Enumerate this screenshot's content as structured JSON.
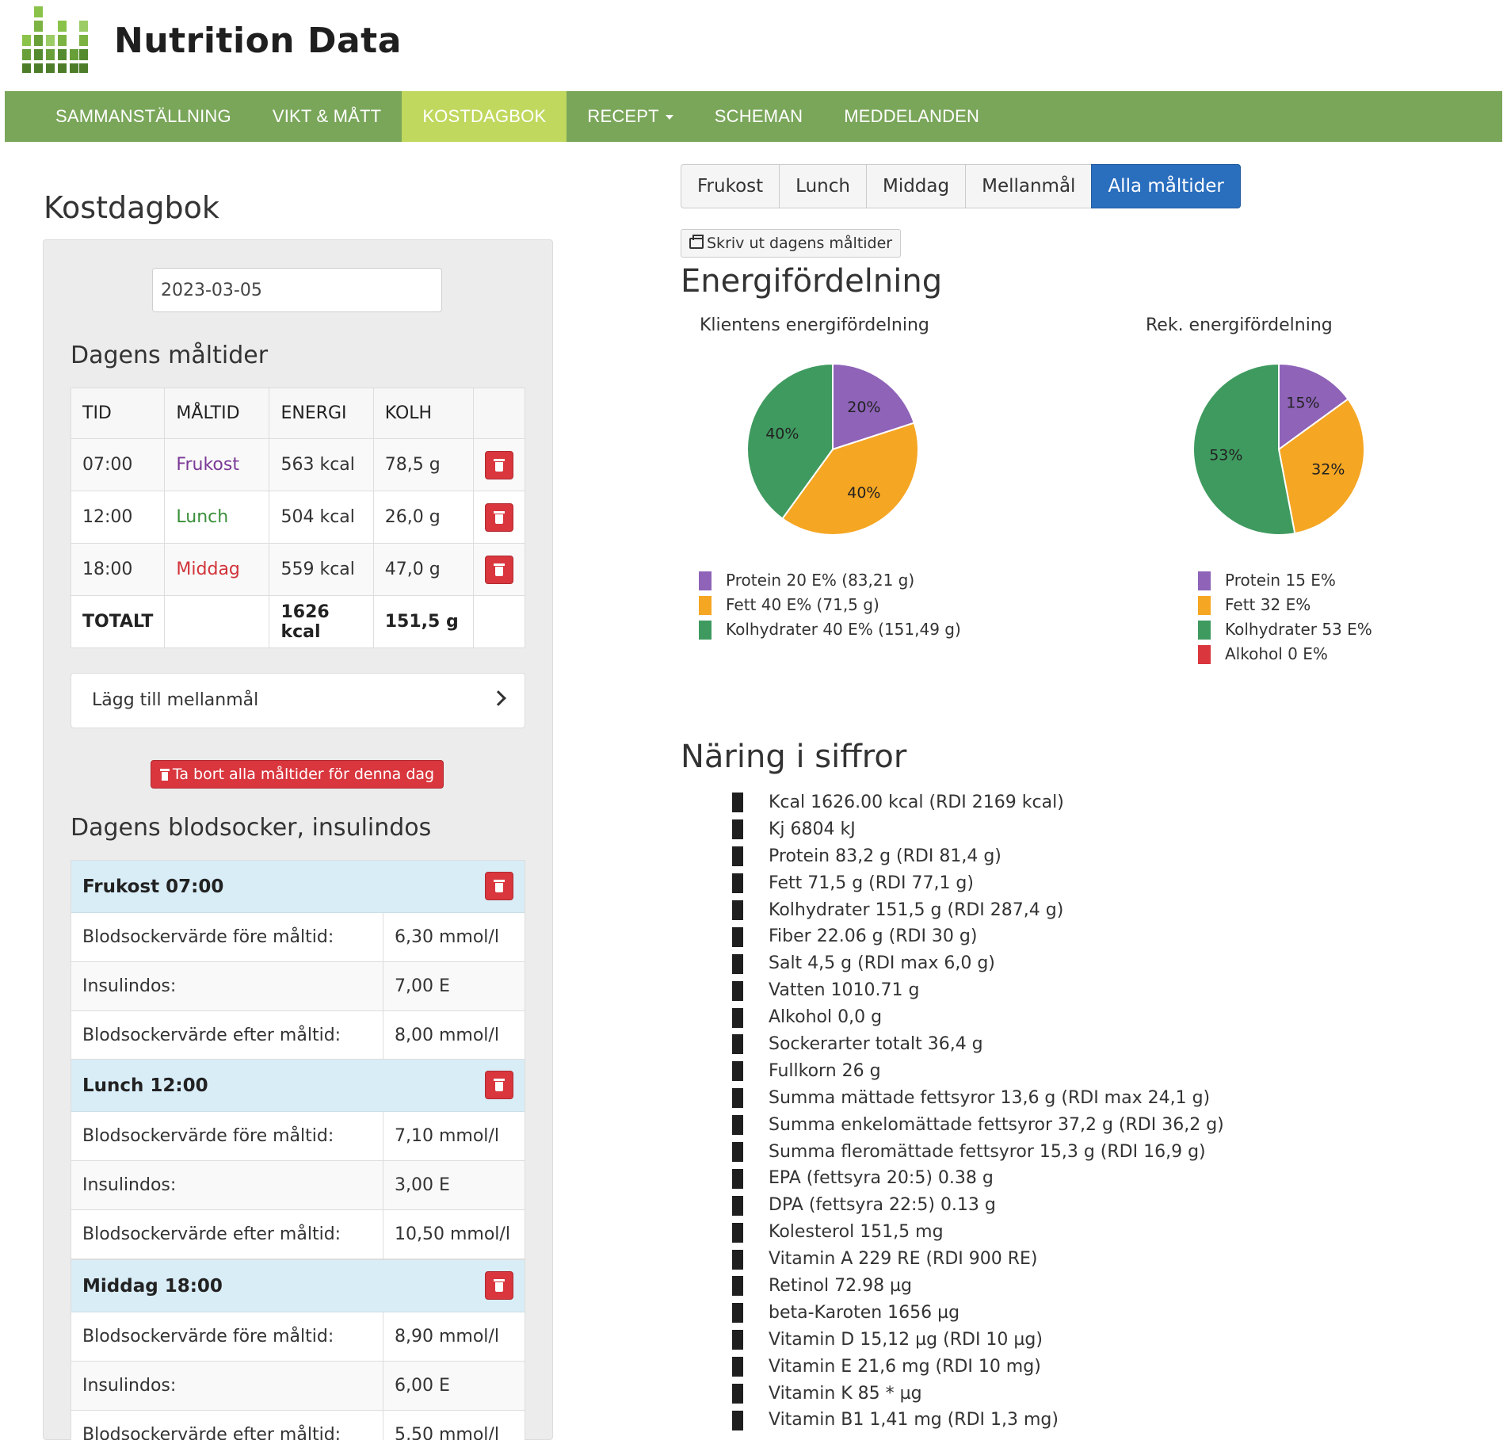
{
  "brand": {
    "name": "Nutrition Data"
  },
  "nav": {
    "items": [
      {
        "label": "SAMMANSTÄLLNING"
      },
      {
        "label": "VIKT & MÅTT"
      },
      {
        "label": "KOSTDAGBOK"
      },
      {
        "label": "RECEPT"
      },
      {
        "label": "SCHEMAN"
      },
      {
        "label": "MEDDELANDEN"
      }
    ],
    "active": "KOSTDAGBOK"
  },
  "page": {
    "title": "Kostdagbok"
  },
  "date": {
    "value": "2023-03-05"
  },
  "meals": {
    "heading": "Dagens måltider",
    "columns": [
      "TID",
      "MÅLTID",
      "ENERGI",
      "KOLH"
    ],
    "rows": [
      {
        "time": "07:00",
        "meal": "Frukost",
        "energy": "563 kcal",
        "carbs": "78,5 g",
        "color": "#7b3a96"
      },
      {
        "time": "12:00",
        "meal": "Lunch",
        "energy": "504 kcal",
        "carbs": "26,0 g",
        "color": "#3a8f3a"
      },
      {
        "time": "18:00",
        "meal": "Middag",
        "energy": "559 kcal",
        "carbs": "47,0 g",
        "color": "#d1343a"
      }
    ],
    "total": {
      "label": "TOTALT",
      "energy": "1626 kcal",
      "carbs": "151,5 g"
    }
  },
  "add_snack": {
    "label": "Lägg till mellanmål"
  },
  "delete_all": {
    "label": "Ta bort alla måltider för denna dag"
  },
  "blood_sugar": {
    "heading": "Dagens blodsocker, insulindos",
    "blocks": [
      {
        "title": "Frukost 07:00",
        "rows": [
          {
            "label": "Blodsockervärde före måltid:",
            "value": "6,30 mmol/l"
          },
          {
            "label": "Insulindos:",
            "value": "7,00 E"
          },
          {
            "label": "Blodsockervärde efter måltid:",
            "value": "8,00 mmol/l"
          }
        ]
      },
      {
        "title": "Lunch 12:00",
        "rows": [
          {
            "label": "Blodsockervärde före måltid:",
            "value": "7,10 mmol/l"
          },
          {
            "label": "Insulindos:",
            "value": "3,00 E"
          },
          {
            "label": "Blodsockervärde efter måltid:",
            "value": "10,50 mmol/l"
          }
        ]
      },
      {
        "title": "Middag 18:00",
        "rows": [
          {
            "label": "Blodsockervärde före måltid:",
            "value": "8,90 mmol/l"
          },
          {
            "label": "Insulindos:",
            "value": "6,00 E"
          },
          {
            "label": "Blodsockervärde efter måltid:",
            "value": "5,50 mmol/l"
          }
        ]
      }
    ]
  },
  "meal_filter": {
    "tabs": [
      "Frukost",
      "Lunch",
      "Middag",
      "Mellanmål",
      "Alla måltider"
    ],
    "active": "Alla måltider"
  },
  "print": {
    "label": "Skriv ut dagens måltider"
  },
  "energy": {
    "heading": "Energifördelning",
    "colors": {
      "protein": "#8e63b8",
      "fat": "#f5a623",
      "carbs": "#3f9a5f",
      "alcohol": "#d9363e"
    }
  },
  "chart_data": [
    {
      "type": "pie",
      "title": "Klientens energifördelning",
      "slices": [
        {
          "name": "Protein",
          "value": 20,
          "label": "20%",
          "color": "#8e63b8"
        },
        {
          "name": "Fett",
          "value": 40,
          "label": "40%",
          "color": "#f5a623"
        },
        {
          "name": "Kolhydrater",
          "value": 40,
          "label": "40%",
          "color": "#3f9a5f"
        }
      ],
      "legend": [
        {
          "text": "Protein 20 E% (83,21 g)",
          "color": "#8e63b8"
        },
        {
          "text": "Fett 40 E% (71,5 g)",
          "color": "#f5a623"
        },
        {
          "text": "Kolhydrater 40 E% (151,49 g)",
          "color": "#3f9a5f"
        }
      ]
    },
    {
      "type": "pie",
      "title": "Rek. energifördelning",
      "slices": [
        {
          "name": "Protein",
          "value": 15,
          "label": "15%",
          "color": "#8e63b8"
        },
        {
          "name": "Fett",
          "value": 32,
          "label": "32%",
          "color": "#f5a623"
        },
        {
          "name": "Kolhydrater",
          "value": 53,
          "label": "53%",
          "color": "#3f9a5f"
        },
        {
          "name": "Alkohol",
          "value": 0,
          "label": "",
          "color": "#d9363e"
        }
      ],
      "legend": [
        {
          "text": "Protein 15 E%",
          "color": "#8e63b8"
        },
        {
          "text": "Fett 32 E%",
          "color": "#f5a623"
        },
        {
          "text": "Kolhydrater 53 E%",
          "color": "#3f9a5f"
        },
        {
          "text": "Alkohol 0 E%",
          "color": "#d9363e"
        }
      ]
    }
  ],
  "nutrition": {
    "heading": "Näring i siffror",
    "items": [
      "Kcal 1626.00 kcal (RDI 2169 kcal)",
      "Kj 6804 kJ",
      "Protein 83,2 g (RDI 81,4 g)",
      "Fett 71,5 g (RDI 77,1 g)",
      "Kolhydrater 151,5 g (RDI 287,4 g)",
      "Fiber 22.06 g (RDI 30 g)",
      "Salt 4,5 g (RDI max 6,0 g)",
      "Vatten 1010.71 g",
      "Alkohol 0,0 g",
      "Sockerarter totalt 36,4 g",
      "Fullkorn 26 g",
      "Summa mättade fettsyror 13,6 g (RDI max 24,1 g)",
      "Summa enkelomättade fettsyror 37,2 g (RDI 36,2 g)",
      "Summa fleromättade fettsyror 15,3 g (RDI 16,9 g)",
      "EPA (fettsyra 20:5) 0.38 g",
      "DPA (fettsyra 22:5) 0.13 g",
      "Kolesterol 151,5 mg",
      "Vitamin A 229 RE (RDI 900 RE)",
      "Retinol 72.98 µg",
      "beta-Karoten 1656 µg",
      "Vitamin D 15,12 µg (RDI 10 µg)",
      "Vitamin E 21,6 mg (RDI 10 mg)",
      "Vitamin K 85 * µg",
      "Vitamin B1 1,41 mg (RDI 1,3 mg)"
    ]
  }
}
